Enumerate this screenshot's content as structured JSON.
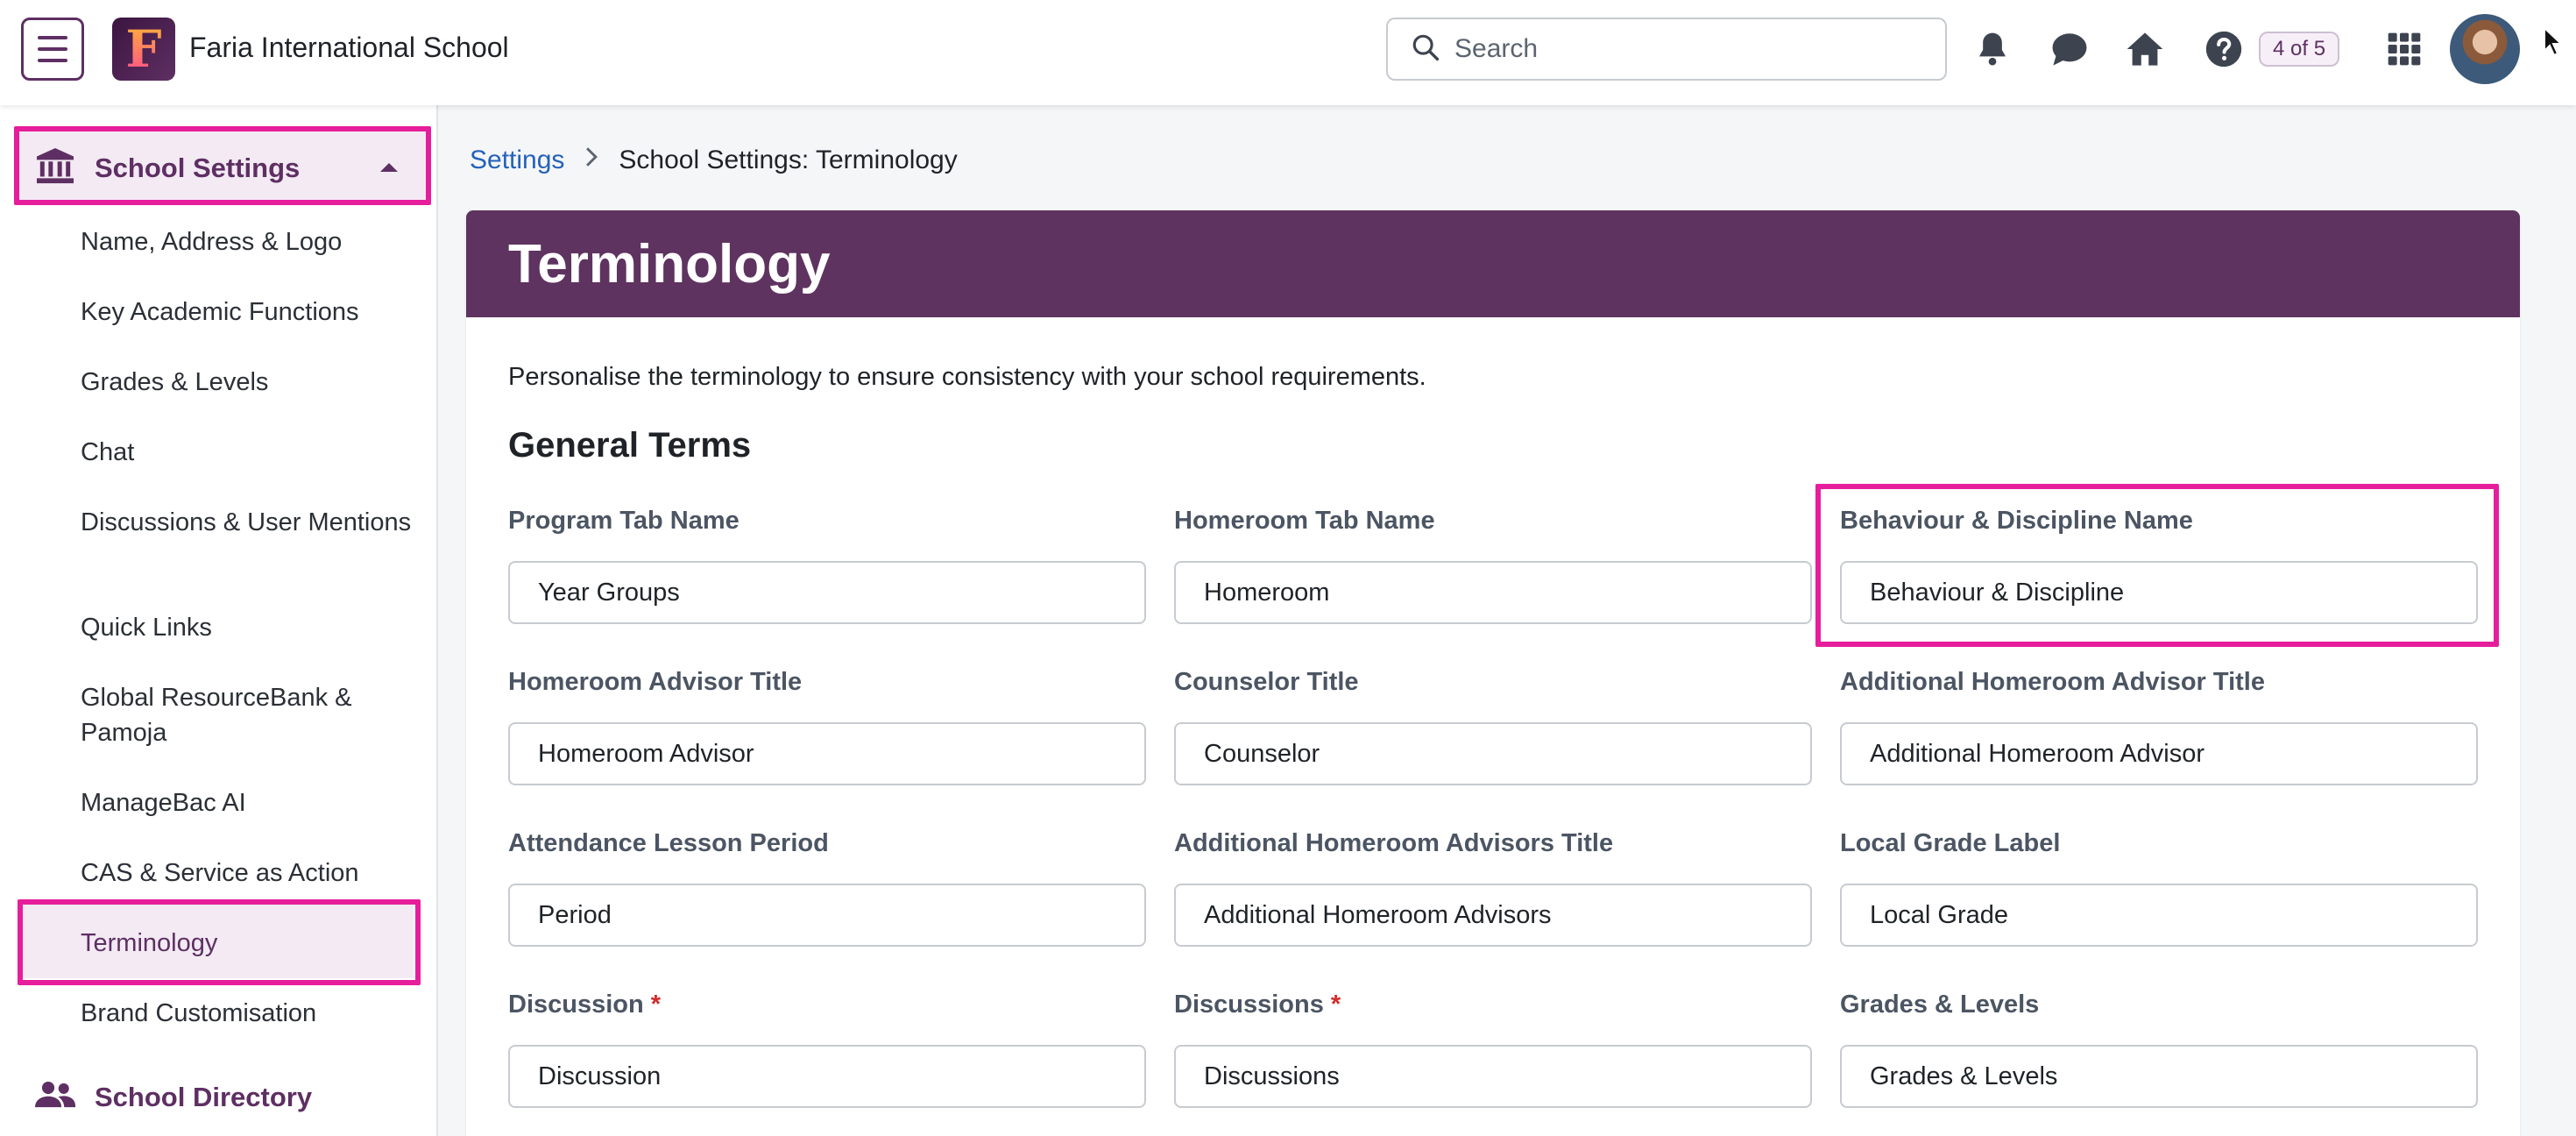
{
  "header": {
    "school_name": "Faria International School",
    "logo_letter": "F",
    "search_placeholder": "Search",
    "pager": "4 of 5"
  },
  "sidebar": {
    "section_label": "School Settings",
    "items": [
      {
        "label": "Name, Address & Logo"
      },
      {
        "label": "Key Academic Functions"
      },
      {
        "label": "Grades & Levels"
      },
      {
        "label": "Chat"
      },
      {
        "label": "Discussions & User Mentions"
      },
      {
        "label": "Quick Links"
      },
      {
        "label": "Global ResourceBank & Pamoja"
      },
      {
        "label": "ManageBac AI"
      },
      {
        "label": "CAS & Service as Action"
      },
      {
        "label": "Terminology"
      },
      {
        "label": "Brand Customisation"
      }
    ],
    "directory_label": "School Directory"
  },
  "breadcrumb": {
    "parent": "Settings",
    "current": "School Settings: Terminology"
  },
  "page": {
    "title": "Terminology",
    "intro": "Personalise the terminology to ensure consistency with your school requirements.",
    "section_title": "General Terms"
  },
  "fields": [
    {
      "label": "Program Tab Name",
      "value": "Year Groups",
      "required": false
    },
    {
      "label": "Homeroom Tab Name",
      "value": "Homeroom",
      "required": false
    },
    {
      "label": "Behaviour & Discipline Name",
      "value": "Behaviour & Discipline",
      "required": false
    },
    {
      "label": "Homeroom Advisor Title",
      "value": "Homeroom Advisor",
      "required": false
    },
    {
      "label": "Counselor Title",
      "value": "Counselor",
      "required": false
    },
    {
      "label": "Additional Homeroom Advisor Title",
      "value": "Additional Homeroom Advisor",
      "required": false
    },
    {
      "label": "Attendance Lesson Period",
      "value": "Period",
      "required": false
    },
    {
      "label": "Additional Homeroom Advisors Title",
      "value": "Additional Homeroom Advisors",
      "required": false
    },
    {
      "label": "Local Grade Label",
      "value": "Local Grade",
      "required": false
    },
    {
      "label": "Discussion",
      "value": "Discussion",
      "required": true,
      "required_mark": "*"
    },
    {
      "label": "Discussions",
      "value": "Discussions",
      "required": true,
      "required_mark": "*"
    },
    {
      "label": "Grades & Levels",
      "value": "Grades & Levels",
      "required": false
    }
  ],
  "colors": {
    "brand": "#5e3360",
    "highlight": "#e61e9b",
    "link": "#2462b8",
    "required": "#d12b2b"
  },
  "icons": {
    "menu": "hamburger-menu-icon",
    "search": "search-icon",
    "notifications": "bell-icon",
    "messages": "chat-bubble-icon",
    "home": "home-icon",
    "help": "help-icon",
    "apps": "apps-grid-icon",
    "section": "institution-icon",
    "directory": "people-icon"
  }
}
